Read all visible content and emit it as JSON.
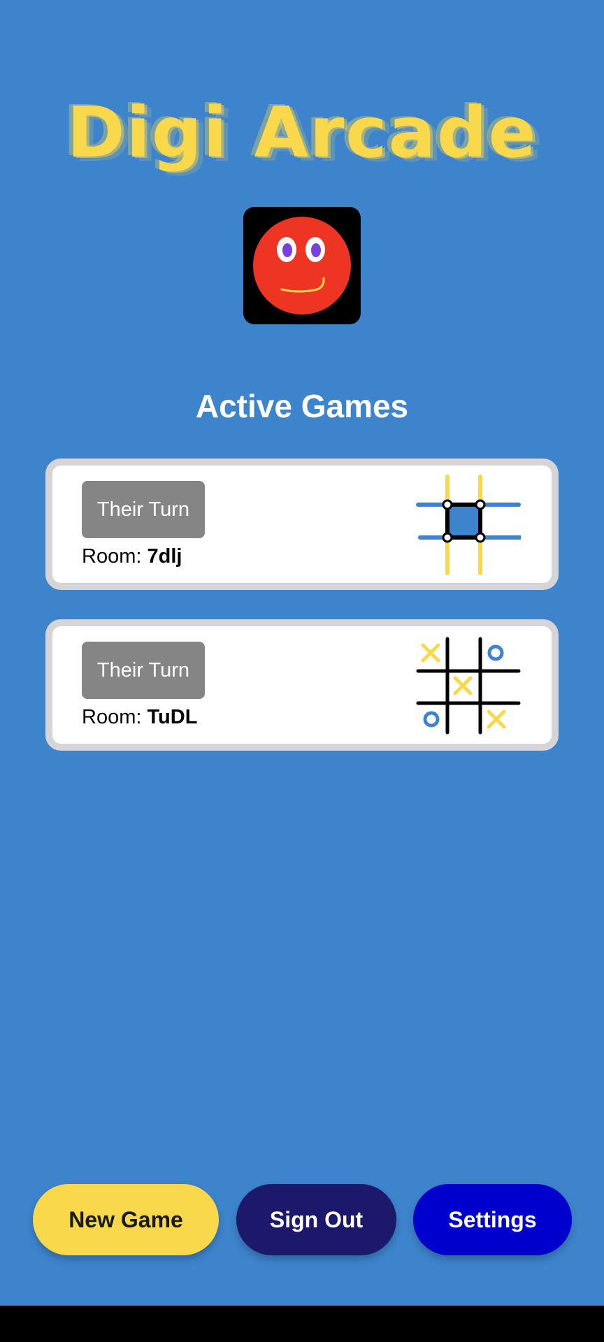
{
  "app": {
    "title": "Digi Arcade"
  },
  "section": {
    "title": "Active Games"
  },
  "games": [
    {
      "status": "Their Turn",
      "room_label": "Room: ",
      "room_code": "7dlj",
      "icon": "dots-and-boxes-icon"
    },
    {
      "status": "Their Turn",
      "room_label": "Room: ",
      "room_code": "TuDL",
      "icon": "tic-tac-toe-icon"
    }
  ],
  "actions": {
    "new_game": "New Game",
    "sign_out": "Sign Out",
    "settings": "Settings"
  },
  "colors": {
    "background": "#3d84cc",
    "title_yellow": "#f9d94b",
    "badge_gray": "#858585",
    "new_game": "#f9d94b",
    "sign_out": "#1c186b",
    "settings": "#0000cc"
  }
}
